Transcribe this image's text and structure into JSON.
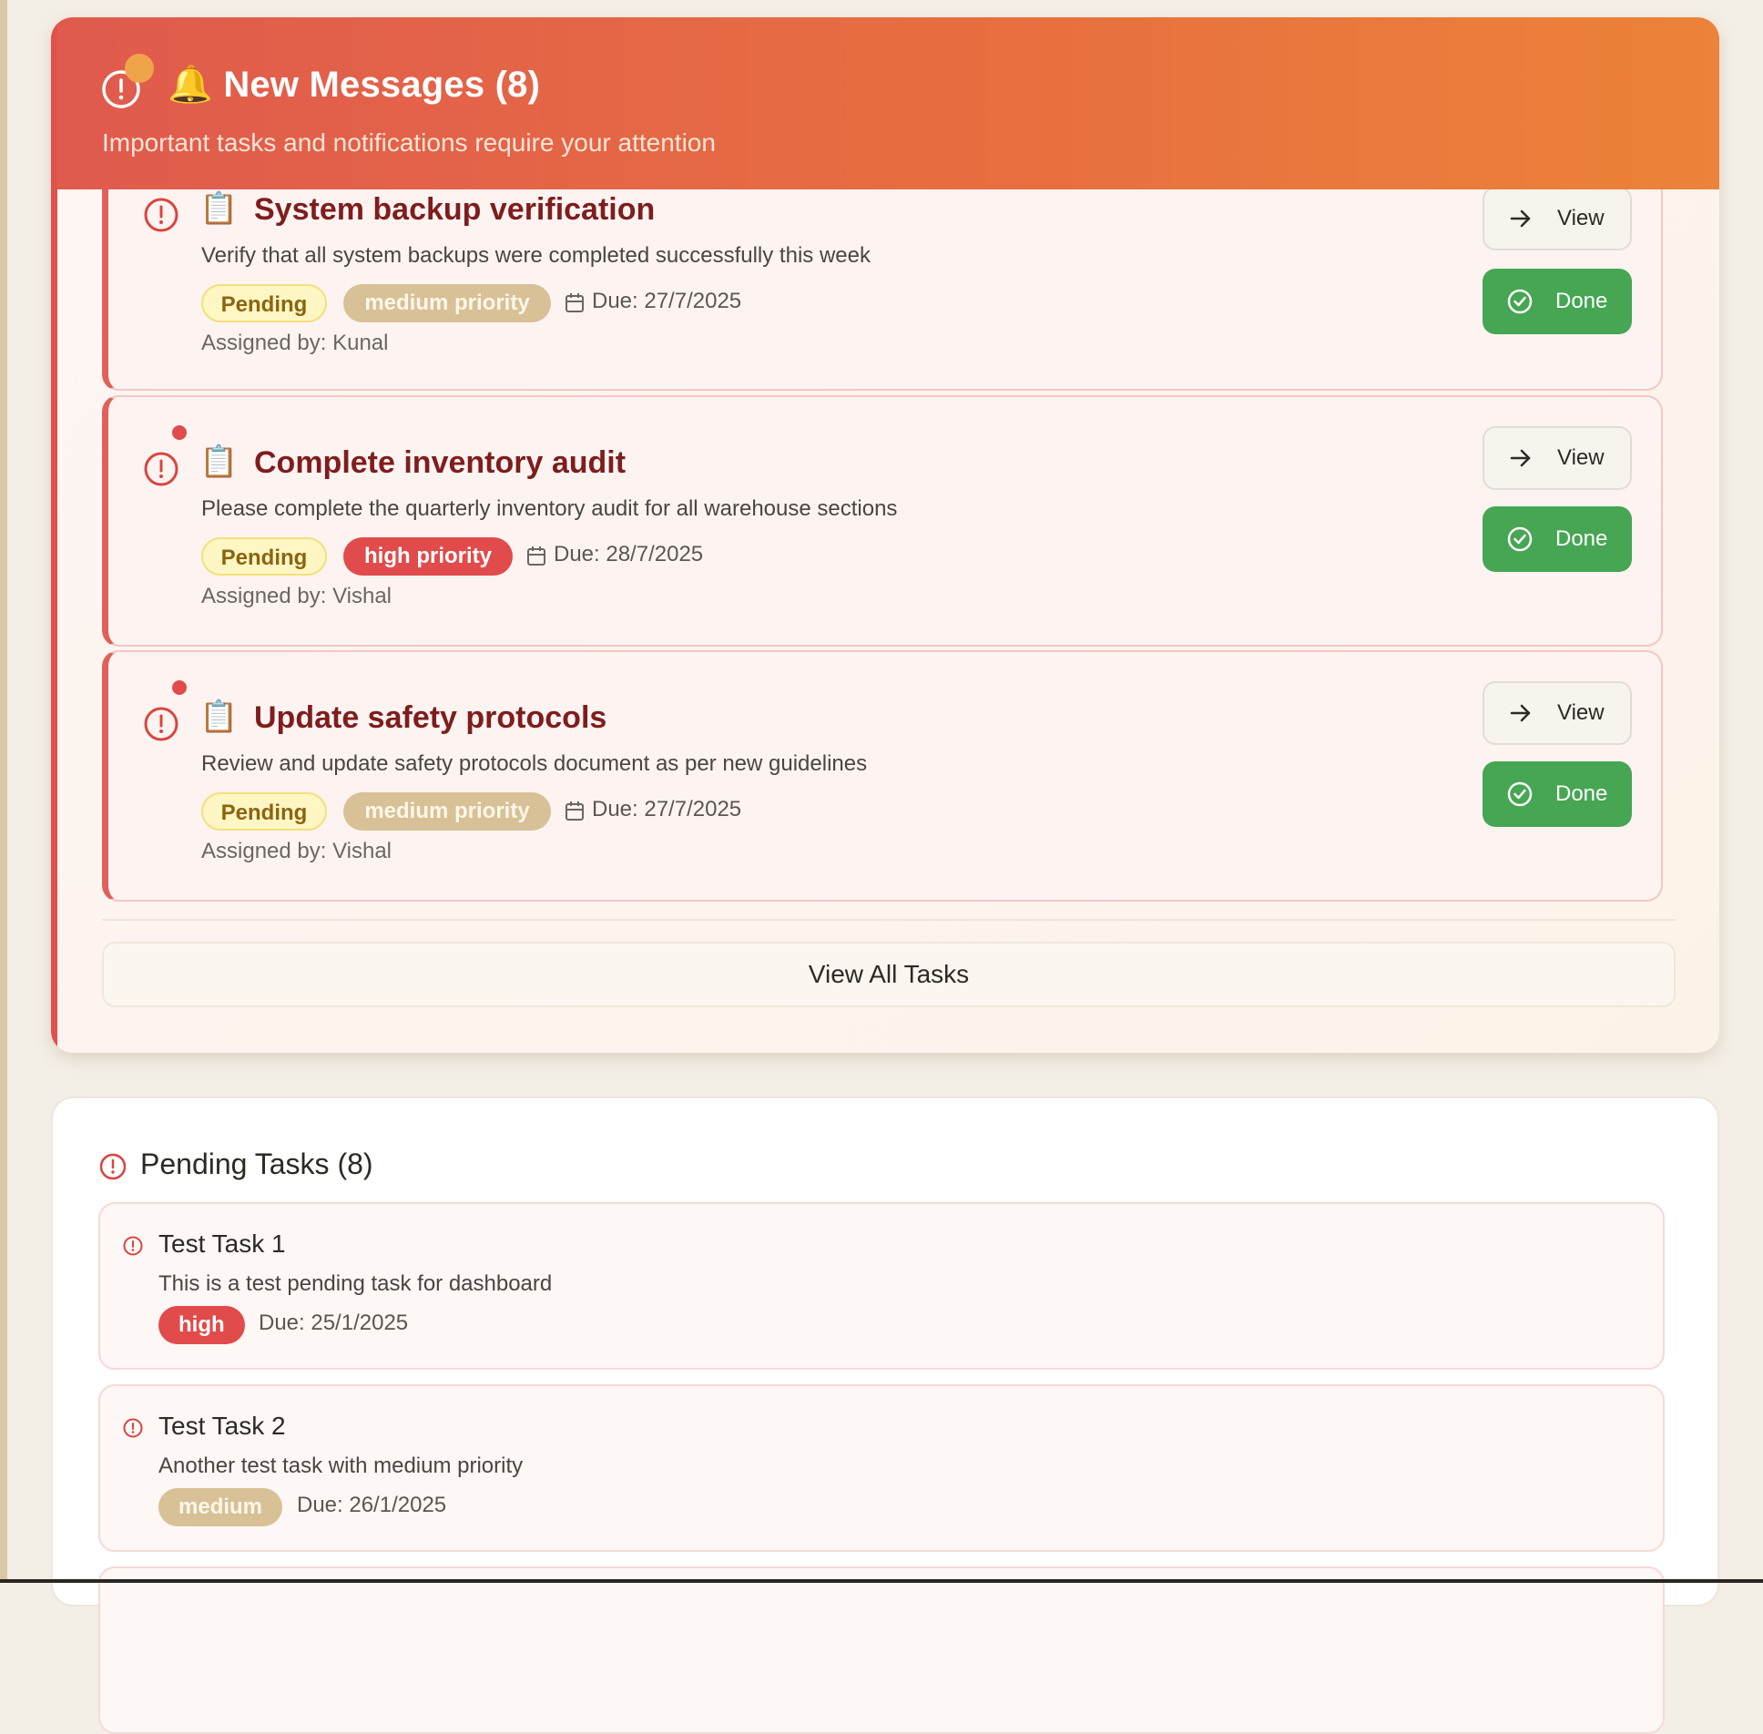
{
  "messages": {
    "title": "🔔 New Messages (8)",
    "subtitle": "Important tasks and notifications require your attention",
    "tasks": [
      {
        "emoji": "📋",
        "title": "System backup verification",
        "description": "Verify that all system backups were completed successfully this week",
        "status": "Pending",
        "priority": "medium priority",
        "priority_level": "medium",
        "due": "Due: 27/7/2025",
        "assigned": "Assigned by: Kunal"
      },
      {
        "emoji": "📋",
        "title": "Complete inventory audit",
        "description": "Please complete the quarterly inventory audit for all warehouse sections",
        "status": "Pending",
        "priority": "high priority",
        "priority_level": "high",
        "due": "Due: 28/7/2025",
        "assigned": "Assigned by: Vishal"
      },
      {
        "emoji": "📋",
        "title": "Update safety protocols",
        "description": "Review and update safety protocols document as per new guidelines",
        "status": "Pending",
        "priority": "medium priority",
        "priority_level": "medium",
        "due": "Due: 27/7/2025",
        "assigned": "Assigned by: Vishal"
      }
    ],
    "view_label": "View",
    "done_label": "Done",
    "view_all_label": "View All Tasks"
  },
  "pending": {
    "title": "Pending Tasks (8)",
    "tasks": [
      {
        "title": "Test Task 1",
        "description": "This is a test pending task for dashboard",
        "priority": "high",
        "due": "Due: 25/1/2025"
      },
      {
        "title": "Test Task 2",
        "description": "Another test task with medium priority",
        "priority": "medium",
        "due": "Due: 26/1/2025"
      }
    ]
  },
  "colors": {
    "header_start": "#e05a4e",
    "header_end": "#ec833a",
    "accent_red": "#e14b4b",
    "done_green": "#46a653",
    "medium_tan": "#d8c196",
    "title_dark_red": "#7f1d1d"
  },
  "icons": {
    "alert": "alert-circle-icon",
    "calendar": "calendar-icon",
    "arrow": "arrow-right-icon",
    "check": "check-circle-icon"
  }
}
